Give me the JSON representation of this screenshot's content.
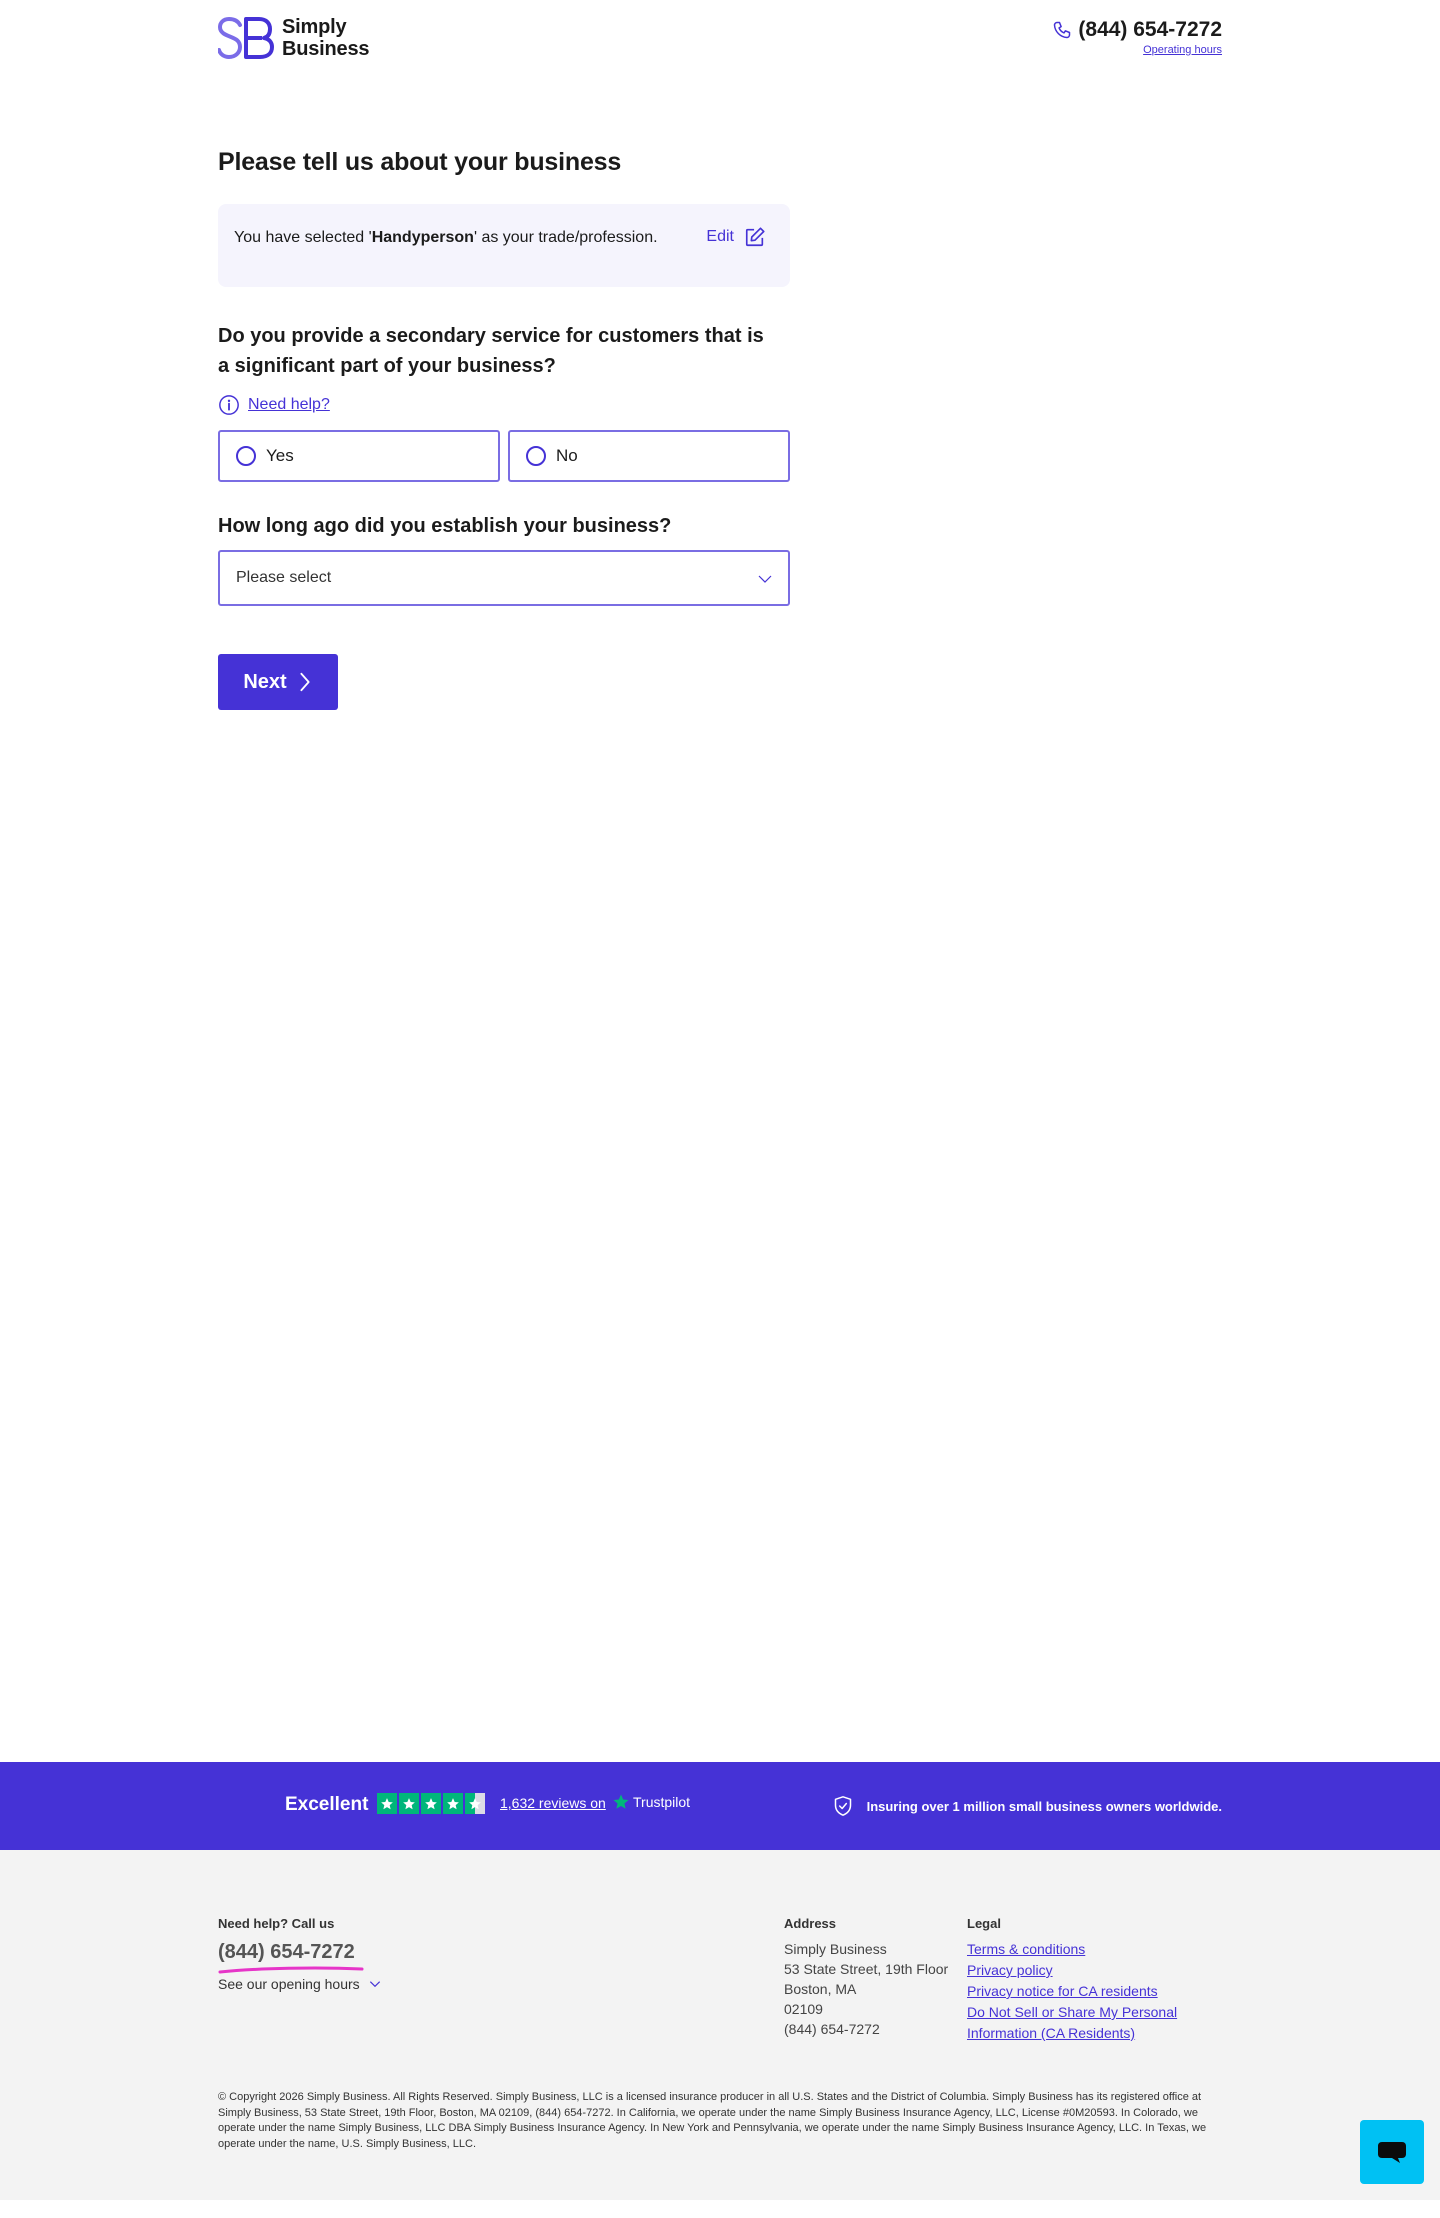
{
  "header": {
    "logo_line1": "Simply",
    "logo_line2": "Business",
    "phone": "(844) 654-7272",
    "operating_hours": "Operating hours"
  },
  "form": {
    "title": "Please tell us about your business",
    "trade_prefix": "You have selected '",
    "trade_name": "Handyperson",
    "trade_suffix": "' as your trade/profession.",
    "edit_label": "Edit",
    "q1": "Do you provide a secondary service for customers that is a significant part of your business?",
    "need_help": "Need help?",
    "yes_label": "Yes",
    "no_label": "No",
    "q2": "How long ago did you establish your business?",
    "select_value": "Please select",
    "next_label": "Next"
  },
  "trust": {
    "excellent": "Excellent",
    "reviews": "1,632 reviews on",
    "trustpilot": "Trustpilot",
    "insuring": "Insuring over 1 million small business owners worldwide.",
    "rating": 4.5
  },
  "footer": {
    "help_heading": "Need help? Call us",
    "help_phone": "(844) 654-7272",
    "opening_hours": "See our opening hours",
    "address_heading": "Address",
    "address_lines": [
      "Simply Business",
      "53 State Street, 19th Floor",
      "Boston, MA",
      "02109",
      "(844) 654-7272"
    ],
    "legal_heading": "Legal",
    "legal_links": [
      "Terms & conditions",
      "Privacy policy",
      "Privacy notice for CA residents",
      "Do Not Sell or Share My Personal",
      "Information (CA Residents)"
    ],
    "copyright": "© Copyright 2026 Simply Business. All Rights Reserved. Simply Business, LLC is a licensed insurance producer in all U.S. States and the District of Columbia. Simply Business has its registered office at Simply Business, 53 State Street, 19th Floor, Boston, MA 02109, (844) 654-7272. In California, we operate under the name Simply Business Insurance Agency, LLC, License #0M20593. In Colorado, we operate under the name Simply Business, LLC DBA Simply Business Insurance Agency. In New York and Pennsylvania, we operate under the name Simply Business Insurance Agency, LLC. In Texas, we operate under the name, U.S. Simply Business, LLC."
  },
  "colors": {
    "brand": "#4532d6",
    "trustpilot_green": "#00b67a",
    "chat": "#00c1f3",
    "accent_underline": "#e635c8"
  }
}
